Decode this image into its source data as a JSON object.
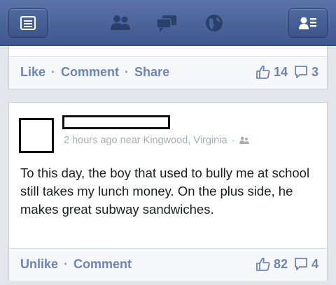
{
  "top_post": {
    "actions": {
      "like": "Like",
      "comment": "Comment",
      "share": "Share",
      "separator": "·"
    },
    "likes": "14",
    "comments": "3"
  },
  "post": {
    "meta": {
      "time": "2 hours ago near Kingwood, Virginia",
      "separator": "·"
    },
    "text": "To this day, the boy that used to bully me at school still takes my lunch money. On the plus side, he makes great subway sandwiches.",
    "actions": {
      "unlike": "Unlike",
      "comment": "Comment",
      "separator": "·"
    },
    "likes": "82",
    "comments": "4"
  },
  "colors": {
    "brand": "#3b5998",
    "link": "#6d84b4",
    "meta": "#a8adb6"
  },
  "icons": {
    "menu": "menu-icon",
    "friends": "friend-requests-icon",
    "messages": "messages-icon",
    "notifications": "notifications-globe-icon",
    "contacts": "contacts-icon"
  }
}
